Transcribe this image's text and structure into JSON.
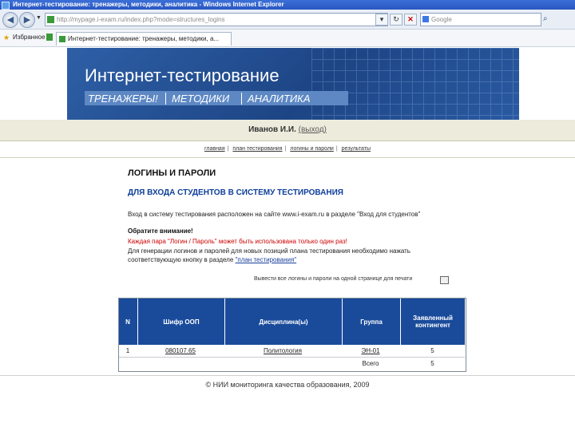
{
  "browser": {
    "title": "Интернет-тестирование: тренажеры, методики, аналитика - Windows Internet Explorer",
    "address": "http://mypage.i-exam.ru/index.php?mode=structures_logins",
    "search_placeholder": "Google",
    "favorites_label": "Избранное",
    "tab_label": "Интернет-тестирование: тренажеры, методики, а..."
  },
  "banner": {
    "title": "Интернет-тестирование",
    "nav": [
      "ТРЕНАЖЕРЫ!",
      "МЕТОДИКИ",
      "АНАЛИТИКА"
    ]
  },
  "user": {
    "name": "Иванов И.И.",
    "logout": "(выход)"
  },
  "menu": [
    "главная",
    "план тестирования",
    "логины и пароли",
    "результаты"
  ],
  "content": {
    "heading": "ЛОГИНЫ И ПАРОЛИ",
    "subheading": "ДЛЯ ВХОДА СТУДЕНТОВ В СИСТЕМУ ТЕСТИРОВАНИЯ",
    "entry_text": "Вход в систему тестирования расположен на сайте www.i-exam.ru в разделе \"Вход для студентов\"",
    "attention_title": "Обратите внимание!",
    "attention_red": "Каждая пара \"Логин / Пароль\" может быть использована только один раз!",
    "generate_line1": "Для генерации логинов и паролей для новых позиций плана тестирования необходимо нажать",
    "generate_line2_prefix": "соответствующую кнопку в разделе ",
    "generate_link": "\"план тестирования\"",
    "print_text": "Вывести все логины и пароли на одной странице для печати"
  },
  "table": {
    "headers": [
      "N",
      "Шифр ООП",
      "Дисциплина(ы)",
      "Группа",
      "Заявленный контингент"
    ],
    "rows": [
      {
        "n": "1",
        "code": "080107.65",
        "discipline": "Политология",
        "group": "ЭН-01",
        "count": "5"
      }
    ],
    "total_label": "Всего",
    "total_value": "5"
  },
  "footer": "© НИИ мониторинга качества образования, 2009"
}
